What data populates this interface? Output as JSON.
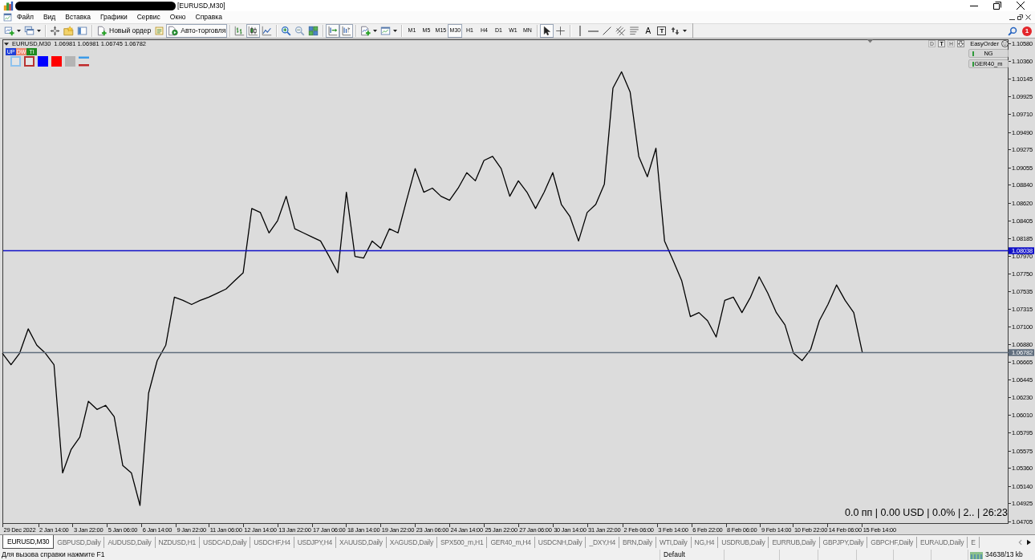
{
  "window": {
    "title": "[EURUSD,M30]"
  },
  "menu": [
    "Файл",
    "Вид",
    "Вставка",
    "Графики",
    "Сервис",
    "Окно",
    "Справка"
  ],
  "toolbar": {
    "groups": [
      [
        {
          "kind": "new-chart"
        },
        {
          "kind": "profiles"
        }
      ],
      [
        {
          "kind": "market-watch"
        },
        {
          "kind": "data-window"
        },
        {
          "kind": "navigator"
        }
      ],
      [
        {
          "kind": "new-order",
          "label": "Новый ордер"
        },
        {
          "kind": "editor"
        },
        {
          "kind": "autotrading",
          "label": "Авто-торговля",
          "on": true
        }
      ],
      [
        {
          "kind": "bar-chart",
          "selected": false
        },
        {
          "kind": "candle-chart",
          "selected": true
        },
        {
          "kind": "line-chart",
          "selected": false
        }
      ],
      [
        {
          "kind": "zoom-in"
        },
        {
          "kind": "zoom-out"
        },
        {
          "kind": "tile"
        }
      ],
      [
        {
          "kind": "autoscroll",
          "on": true
        },
        {
          "kind": "chart-shift",
          "on": true
        }
      ],
      [
        {
          "kind": "indicators"
        },
        {
          "kind": "templates"
        }
      ],
      [
        {
          "kind": "period",
          "label": "M1",
          "selected": false
        },
        {
          "kind": "period",
          "label": "M5",
          "selected": false
        },
        {
          "kind": "period",
          "label": "M15",
          "selected": false
        },
        {
          "kind": "period",
          "label": "M30",
          "selected": true
        },
        {
          "kind": "period",
          "label": "H1",
          "selected": false
        },
        {
          "kind": "period",
          "label": "H4",
          "selected": false
        },
        {
          "kind": "period",
          "label": "D1",
          "selected": false
        },
        {
          "kind": "period",
          "label": "W1",
          "selected": false
        },
        {
          "kind": "period",
          "label": "MN",
          "selected": false
        }
      ],
      [
        {
          "kind": "cursor",
          "selected": true
        },
        {
          "kind": "crosshair",
          "selected": false
        }
      ],
      [
        {
          "kind": "vline"
        },
        {
          "kind": "hline"
        },
        {
          "kind": "trendline"
        },
        {
          "kind": "channel"
        },
        {
          "kind": "fibo"
        },
        {
          "kind": "text",
          "label": "A"
        },
        {
          "kind": "text-label",
          "label": "T"
        },
        {
          "kind": "arrows"
        }
      ]
    ],
    "notifications": "1"
  },
  "chart": {
    "legend": {
      "symbol": "EURUSD,M30",
      "prices": "1.06981 1.06981 1.06745 1.06782"
    },
    "signal_buttons": [
      {
        "label": "UP",
        "color": "#1f3fd8"
      },
      {
        "label": "DW",
        "color": "#ee8a72"
      },
      {
        "label": "TI",
        "color": "#1e8a1e"
      }
    ],
    "swatches": [
      {
        "kind": "outline",
        "color": "#8ec3ee"
      },
      {
        "kind": "outline",
        "color": "#b83232"
      },
      {
        "kind": "fill",
        "color": "#0000ff"
      },
      {
        "kind": "fill",
        "color": "#ff0000"
      },
      {
        "kind": "fill",
        "color": "#b4b4b4"
      }
    ],
    "easy_order": {
      "title": "EasyOrder",
      "mode_buttons": [
        {
          "label": "D",
          "disabled": true
        },
        {
          "label": "T",
          "disabled": false
        },
        {
          "label": "H",
          "disabled": true
        }
      ],
      "symbols": [
        "NG",
        "GER40_m"
      ]
    },
    "chart_data": [
      {
        "type": "line",
        "color": "#000000",
        "categories": [
          null,
          null,
          "29 Dec 2022",
          null,
          null,
          null,
          "2 Jan 14:00",
          null,
          null,
          null,
          "3 Jan 22:00",
          null,
          null,
          null,
          "5 Jan 06:00",
          null,
          null,
          null,
          "6 Jan 14:00",
          null,
          null,
          null,
          "9 Jan 22:00",
          null,
          null,
          null,
          "11 Jan 06:00",
          null,
          null,
          null,
          "12 Jan 14:00",
          null,
          null,
          null,
          "13 Jan 22:00",
          null,
          null,
          null,
          "17 Jan 06:00",
          null,
          null,
          null,
          "18 Jan 14:00",
          null,
          null,
          null,
          "19 Jan 22:00",
          null,
          null,
          null,
          "23 Jan 06:00",
          null,
          null,
          null,
          "24 Jan 14:00",
          null,
          null,
          null,
          "25 Jan 22:00",
          null,
          null,
          null,
          "27 Jan 06:00",
          null,
          null,
          null,
          "30 Jan 14:00",
          null,
          null,
          null,
          "31 Jan 22:00",
          null,
          null,
          null,
          "2 Feb 06:00",
          null,
          null,
          null,
          "3 Feb 14:00",
          null,
          null,
          null,
          "6 Feb 22:00",
          null,
          null,
          null,
          "8 Feb 06:00",
          null,
          null,
          null,
          "9 Feb 14:00",
          null,
          null,
          null,
          "10 Feb 22:00",
          null,
          null,
          null,
          "14 Feb 06:00",
          null,
          null,
          null,
          "15 Feb 14:00",
          null,
          null,
          null,
          null,
          null,
          null,
          null,
          null,
          null,
          null,
          null,
          null,
          null,
          null
        ],
        "values": [
          1.0677,
          1.0663,
          1.0677,
          1.0707,
          1.0687,
          1.0677,
          1.0663,
          1.053,
          1.0559,
          1.0574,
          1.0618,
          1.0608,
          1.0613,
          1.0599,
          1.0539,
          1.053,
          1.049,
          1.0628,
          1.0668,
          1.0687,
          1.0746,
          1.0742,
          1.0737,
          1.0742,
          1.0746,
          1.0751,
          1.0756,
          1.0766,
          1.0776,
          1.0855,
          1.085,
          1.0825,
          1.084,
          1.087,
          1.083,
          1.0825,
          1.082,
          1.0815,
          1.0796,
          1.0776,
          1.0875,
          1.0796,
          1.0794,
          1.0815,
          1.0806,
          1.083,
          1.0825,
          1.0865,
          1.0904,
          1.0875,
          1.088,
          1.087,
          1.0865,
          1.088,
          1.0899,
          1.0889,
          1.0914,
          1.0919,
          1.0904,
          1.087,
          1.0889,
          1.0875,
          1.0855,
          1.0875,
          1.0899,
          1.086,
          1.0845,
          1.0815,
          1.085,
          1.086,
          1.0885,
          1.1003,
          1.1023,
          1.0998,
          1.0919,
          1.0894,
          1.0929,
          1.0815,
          1.0791,
          1.0766,
          1.0722,
          1.0727,
          1.0717,
          1.0697,
          1.0742,
          1.0746,
          1.0727,
          1.0746,
          1.0771,
          1.0751,
          1.0727,
          1.0712,
          1.0677,
          1.0668,
          1.0682,
          1.0717,
          1.0737,
          1.0761,
          1.0742,
          1.0727,
          1.0678,
          null,
          null,
          null,
          null,
          null,
          null,
          null,
          null,
          null,
          null,
          null,
          null,
          null,
          null,
          null,
          null
        ],
        "ylim": [
          1.04673,
          1.10629
        ],
        "yticks": [
          {
            "value": 1.1058,
            "label": "1.10580"
          },
          {
            "value": 1.1036,
            "label": "1.10360"
          },
          {
            "value": 1.10145,
            "label": "1.10145"
          },
          {
            "value": 1.09925,
            "label": "1.09925"
          },
          {
            "value": 1.0971,
            "label": "1.09710"
          },
          {
            "value": 1.0949,
            "label": "1.09490"
          },
          {
            "value": 1.09275,
            "label": "1.09275"
          },
          {
            "value": 1.09055,
            "label": "1.09055"
          },
          {
            "value": 1.0884,
            "label": "1.08840"
          },
          {
            "value": 1.0862,
            "label": "1.08620"
          },
          {
            "value": 1.08405,
            "label": "1.08405"
          },
          {
            "value": 1.08185,
            "label": "1.08185"
          },
          {
            "value": 1.0797,
            "label": "1.07970"
          },
          {
            "value": 1.0775,
            "label": "1.07750"
          },
          {
            "value": 1.07535,
            "label": "1.07535"
          },
          {
            "value": 1.07315,
            "label": "1.07315"
          },
          {
            "value": 1.071,
            "label": "1.07100"
          },
          {
            "value": 1.0688,
            "label": "1.06880"
          },
          {
            "value": 1.06665,
            "label": "1.06665"
          },
          {
            "value": 1.06445,
            "label": "1.06445"
          },
          {
            "value": 1.0623,
            "label": "1.06230"
          },
          {
            "value": 1.0601,
            "label": "1.06010"
          },
          {
            "value": 1.05795,
            "label": "1.05795"
          },
          {
            "value": 1.05575,
            "label": "1.05575"
          },
          {
            "value": 1.0536,
            "label": "1.05360"
          },
          {
            "value": 1.0514,
            "label": "1.05140"
          },
          {
            "value": 1.04925,
            "label": "1.04925"
          },
          {
            "value": 1.04705,
            "label": "1.04705"
          }
        ],
        "ref_lines": [
          {
            "axis": "y",
            "value": 1.08038,
            "label": "1.08038",
            "color": "#1010c8"
          },
          {
            "axis": "y",
            "value": 1.06782,
            "label": "1.06782",
            "color": "#5f6d7d"
          }
        ]
      }
    ],
    "account_info": "0.0 пп | 0.00 USD | 0.0% | 2.. | 26:23"
  },
  "tabs": [
    {
      "label": "EURUSD,M30",
      "selected": true
    },
    {
      "label": "GBPUSD,Daily",
      "selected": false
    },
    {
      "label": "AUDUSD,Daily",
      "selected": false
    },
    {
      "label": "NZDUSD,H1",
      "selected": false
    },
    {
      "label": "USDCAD,Daily",
      "selected": false
    },
    {
      "label": "USDCHF,H4",
      "selected": false
    },
    {
      "label": "USDJPY,H4",
      "selected": false
    },
    {
      "label": "XAUUSD,Daily",
      "selected": false
    },
    {
      "label": "XAGUSD,Daily",
      "selected": false
    },
    {
      "label": "SPX500_m,H1",
      "selected": false
    },
    {
      "label": "GER40_m,H4",
      "selected": false
    },
    {
      "label": "USDCNH,Daily",
      "selected": false
    },
    {
      "label": "_DXY,H4",
      "selected": false
    },
    {
      "label": "BRN,Daily",
      "selected": false
    },
    {
      "label": "WTI,Daily",
      "selected": false
    },
    {
      "label": "NG,H4",
      "selected": false
    },
    {
      "label": "USDRUB,Daily",
      "selected": false
    },
    {
      "label": "EURRUB,Daily",
      "selected": false
    },
    {
      "label": "GBPJPY,Daily",
      "selected": false
    },
    {
      "label": "GBPCHF,Daily",
      "selected": false
    },
    {
      "label": "EURAUD,Daily",
      "selected": false
    },
    {
      "label": "E",
      "selected": false
    }
  ],
  "status_bar": {
    "help": "Для вызова справки нажмите F1",
    "profile": "Default",
    "traffic": "34638/13 kb"
  }
}
